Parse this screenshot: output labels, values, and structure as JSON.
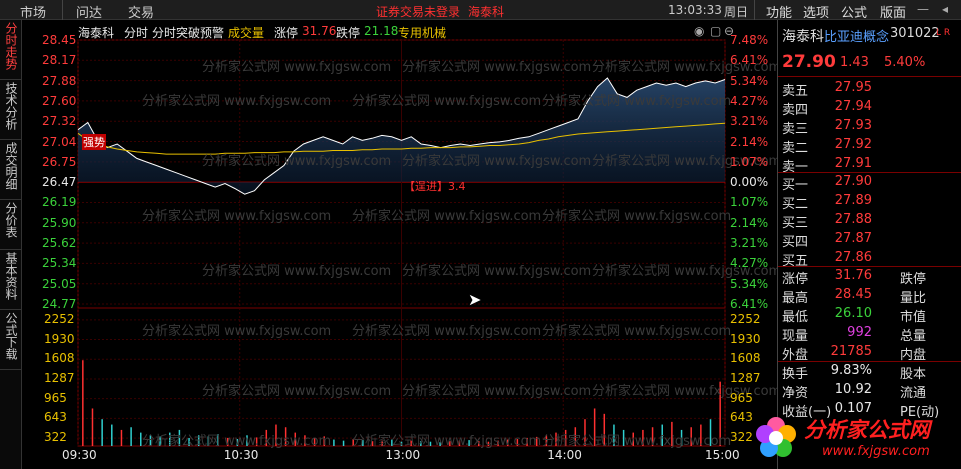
{
  "topbar": {
    "menu_market": "市场",
    "menu_wenda": "问达",
    "menu_trade": "交易",
    "notice": "证券交易未登录",
    "notice_stock": "海泰科",
    "time": "13:03:33",
    "weekday": "周日",
    "right_menu": [
      "功能",
      "选项",
      "公式",
      "版面"
    ]
  },
  "leftnav": {
    "tabs": [
      "分时走势",
      "技术分析",
      "成交明细",
      "分价表",
      "基本资料",
      "公式下载"
    ]
  },
  "chart_header": {
    "stock": "海泰科",
    "mode": "分时",
    "alert": "分时突破预警",
    "volume_label": "成交量",
    "limit_up_label": "涨停",
    "limit_up_value": "31.76",
    "limit_down_label": "跌停",
    "limit_down_value": "21.18",
    "sector": "专用机械"
  },
  "annotations": {
    "strong": "强势",
    "fast_enter": "【逞进】3.4"
  },
  "watermark": "分析家公式网 www.fxjgsw.com",
  "chart_data": {
    "type": "line",
    "price_axis": {
      "left_labels": [
        "28.45",
        "28.17",
        "27.88",
        "27.60",
        "27.32",
        "27.04",
        "26.75",
        "26.47",
        "26.19",
        "25.90",
        "25.62",
        "25.34",
        "25.05",
        "24.77"
      ],
      "right_labels": [
        "7.48%",
        "6.41%",
        "5.34%",
        "4.27%",
        "3.21%",
        "2.14%",
        "1.07%",
        "0.00%",
        "1.07%",
        "2.14%",
        "3.21%",
        "4.27%",
        "5.34%",
        "6.41%"
      ],
      "ylim": [
        24.77,
        28.45
      ],
      "prev_close": 26.47
    },
    "volume_axis": {
      "labels": [
        "2252",
        "1930",
        "1608",
        "1287",
        "965",
        "643",
        "322"
      ],
      "ylim": [
        0,
        2574
      ]
    },
    "x_labels": [
      "09:30",
      "10:30",
      "13:00",
      "14:00",
      "15:00"
    ],
    "series": [
      {
        "values": [
          27.2,
          27.3,
          27.05,
          26.95,
          27.0,
          26.9,
          26.8,
          26.75,
          26.7,
          26.65,
          26.6,
          26.55,
          26.5,
          26.45,
          26.4,
          26.45,
          26.38,
          26.3,
          26.35,
          26.5,
          26.6,
          26.7,
          26.9,
          27.0,
          27.05,
          27.1,
          27.05,
          27.0,
          27.1,
          27.05,
          27.08,
          27.12,
          27.1,
          27.05,
          27.1,
          27.0,
          26.98,
          26.95,
          26.98,
          27.0,
          26.98,
          27.0,
          27.02,
          27.03,
          27.05,
          27.08,
          27.1,
          27.15,
          27.2,
          27.25,
          27.3,
          27.35,
          27.6,
          27.8,
          27.92,
          27.7,
          27.65,
          27.75,
          27.8,
          27.85,
          27.82,
          27.85,
          27.8,
          27.85,
          27.88,
          27.85,
          27.9
        ]
      },
      {
        "values": [
          27.15,
          27.05,
          27.0,
          26.96,
          26.93,
          26.91,
          26.89,
          26.88,
          26.87,
          26.86,
          26.86,
          26.86,
          26.86,
          26.86,
          26.86,
          26.87,
          26.87,
          26.87,
          26.88,
          26.88,
          26.88,
          26.89,
          26.89,
          26.9,
          26.9,
          26.9,
          26.91,
          26.91,
          26.91,
          26.92,
          26.92,
          26.93,
          26.93,
          26.93,
          26.94,
          26.94,
          26.95,
          26.95,
          26.95,
          26.96,
          26.96,
          26.97,
          26.98,
          26.98,
          26.99,
          27.0,
          27.02,
          27.05,
          27.07,
          27.1,
          27.12,
          27.14,
          27.15,
          27.16,
          27.17,
          27.18,
          27.19,
          27.2,
          27.21,
          27.22,
          27.23,
          27.24,
          27.25,
          27.26,
          27.27,
          27.28,
          27.29
        ]
      }
    ],
    "volume": [
      1600,
      700,
      500,
      400,
      300,
      350,
      250,
      200,
      180,
      250,
      300,
      150,
      200,
      180,
      220,
      150,
      130,
      200,
      160,
      300,
      400,
      350,
      250,
      200,
      150,
      180,
      120,
      100,
      130,
      110,
      90,
      100,
      120,
      80,
      100,
      90,
      80,
      70,
      90,
      100,
      110,
      90,
      80,
      100,
      120,
      130,
      150,
      170,
      200,
      250,
      300,
      350,
      500,
      700,
      600,
      400,
      300,
      250,
      300,
      350,
      400,
      450,
      300,
      350,
      400,
      500,
      1200
    ]
  },
  "rightpanel": {
    "stock_name": "海泰科",
    "concept": "比亚迪概念",
    "code": "301022",
    "lr": "L R",
    "price": "27.90",
    "change": "1.43",
    "change_pct": "5.40%",
    "asks": [
      {
        "label": "卖五",
        "price": "27.95"
      },
      {
        "label": "卖四",
        "price": "27.94"
      },
      {
        "label": "卖三",
        "price": "27.93"
      },
      {
        "label": "卖二",
        "price": "27.92"
      },
      {
        "label": "卖一",
        "price": "27.91"
      }
    ],
    "bids": [
      {
        "label": "买一",
        "price": "27.90"
      },
      {
        "label": "买二",
        "price": "27.89"
      },
      {
        "label": "买三",
        "price": "27.88"
      },
      {
        "label": "买四",
        "price": "27.87"
      },
      {
        "label": "买五",
        "price": "27.86"
      }
    ],
    "stats": [
      {
        "label": "涨停",
        "value": "31.76",
        "color": "red",
        "label2": "跌停"
      },
      {
        "label": "最高",
        "value": "28.45",
        "color": "red",
        "label2": "量比"
      },
      {
        "label": "最低",
        "value": "26.10",
        "color": "green",
        "label2": "市值"
      },
      {
        "label": "现量",
        "value": "992",
        "color": "magenta",
        "label2": "总量"
      },
      {
        "label": "外盘",
        "value": "21785",
        "color": "red",
        "label2": "内盘"
      }
    ],
    "stats2": [
      {
        "label": "换手",
        "value": "9.83%",
        "label2": "股本"
      },
      {
        "label": "净资",
        "value": "10.92",
        "label2": "流通"
      },
      {
        "label": "收益(一)",
        "value": "0.107",
        "label2": "PE(动)"
      }
    ],
    "logo_text": "分析家公式网",
    "logo_url": "www.fxjgsw.com"
  }
}
